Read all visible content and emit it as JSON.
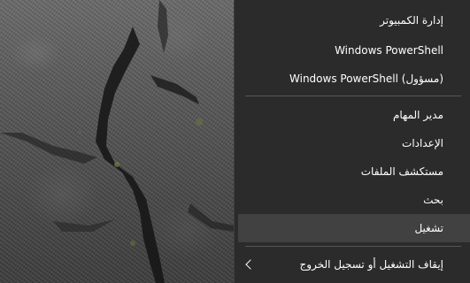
{
  "menu": {
    "group1": [
      {
        "label": "إدارة الكمبيوتر"
      },
      {
        "label": "Windows PowerShell"
      },
      {
        "label": "Windows PowerShell (مسؤول)"
      }
    ],
    "group2": [
      {
        "label": "مدير المهام"
      },
      {
        "label": "الإعدادات"
      },
      {
        "label": "مستكشف الملفات"
      },
      {
        "label": "بحث"
      },
      {
        "label": "تشغيل"
      }
    ],
    "group3": [
      {
        "label": "إيقاف التشغيل أو تسجيل الخروج",
        "icon": "chevron-left-icon"
      }
    ],
    "highlighted_item": "تشغيل"
  },
  "colors": {
    "menu_background": "#2b2b2b",
    "highlight": "#414141",
    "separator": "#555555",
    "text": "#ffffff"
  },
  "wallpaper": {
    "description_icon": "rock-texture"
  }
}
